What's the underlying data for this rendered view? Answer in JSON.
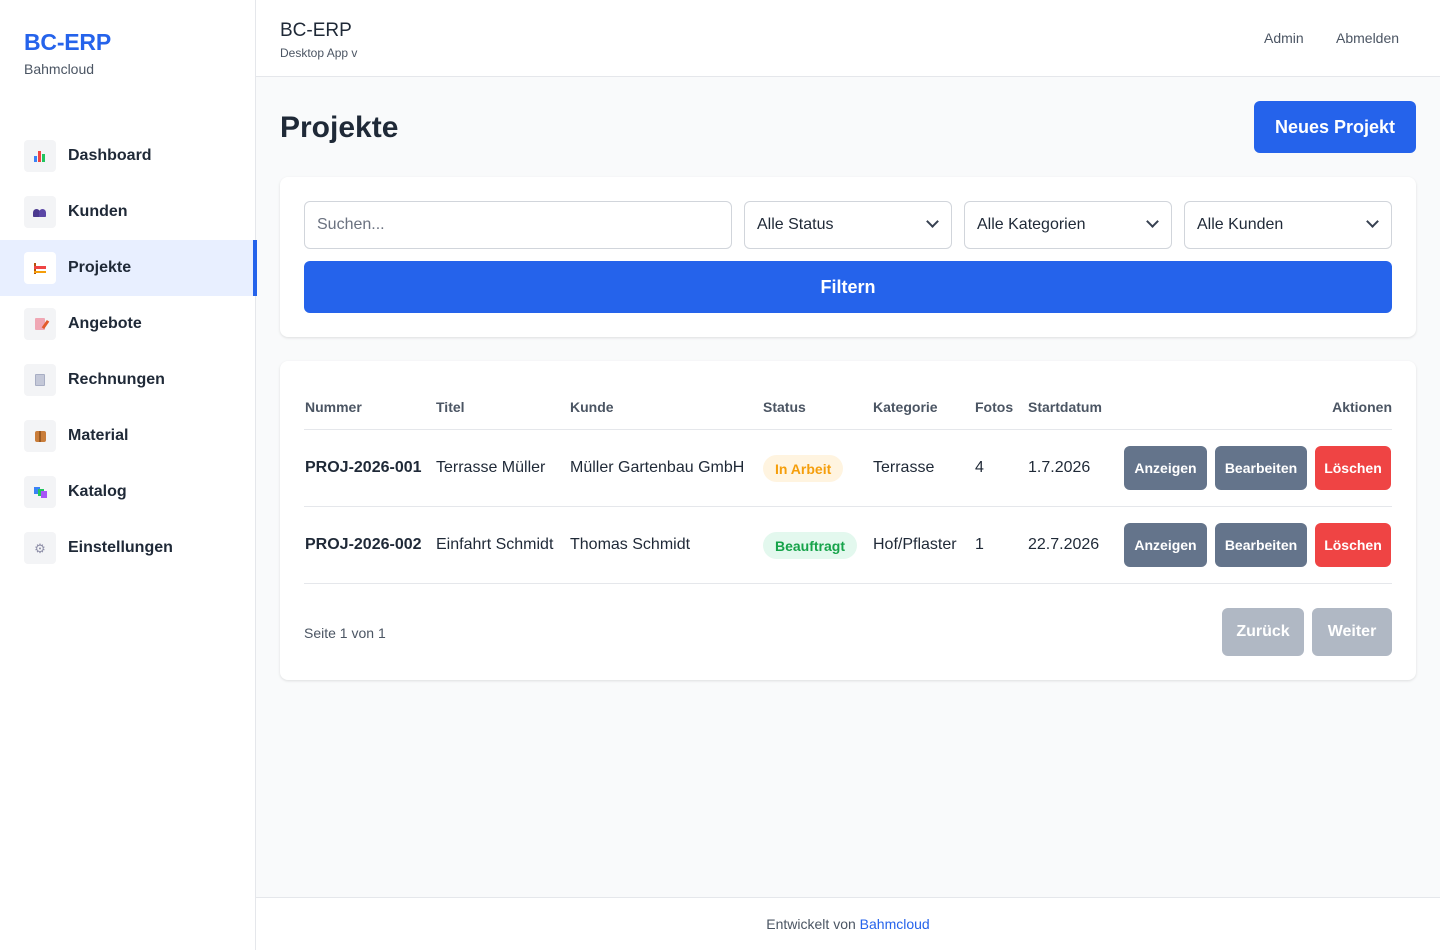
{
  "brand": {
    "title": "BC-ERP",
    "subtitle": "Bahmcloud"
  },
  "sidebar": {
    "items": [
      {
        "label": "Dashboard",
        "icon": "bar-chart-icon",
        "active": false
      },
      {
        "label": "Kunden",
        "icon": "users-icon",
        "active": false
      },
      {
        "label": "Projekte",
        "icon": "construction-icon",
        "active": true
      },
      {
        "label": "Angebote",
        "icon": "memo-icon",
        "active": false
      },
      {
        "label": "Rechnungen",
        "icon": "receipt-icon",
        "active": false
      },
      {
        "label": "Material",
        "icon": "package-icon",
        "active": false
      },
      {
        "label": "Katalog",
        "icon": "books-icon",
        "active": false
      },
      {
        "label": "Einstellungen",
        "icon": "gear-icon",
        "active": false
      }
    ]
  },
  "header": {
    "title": "BC-ERP",
    "subtitle": "Desktop App v",
    "admin_label": "Admin",
    "logout_label": "Abmelden"
  },
  "main": {
    "title": "Projekte",
    "new_button": "Neues Projekt"
  },
  "filters": {
    "search_placeholder": "Suchen...",
    "status_value": "Alle Status",
    "category_value": "Alle Kategorien",
    "customer_value": "Alle Kunden",
    "filter_button": "Filtern"
  },
  "table": {
    "columns": {
      "number": "Nummer",
      "title": "Titel",
      "customer": "Kunde",
      "status": "Status",
      "category": "Kategorie",
      "photos": "Fotos",
      "start": "Startdatum",
      "actions": "Aktionen"
    },
    "rows": [
      {
        "number": "PROJ-2026-001",
        "title": "Terrasse Müller",
        "customer": "Müller Gartenbau GmbH",
        "status": "In Arbeit",
        "category": "Terrasse",
        "photos": "4",
        "start": "1.7.2026"
      },
      {
        "number": "PROJ-2026-002",
        "title": "Einfahrt Schmidt",
        "customer": "Thomas Schmidt",
        "status": "Beauftragt",
        "category": "Hof/Pflaster",
        "photos": "1",
        "start": "22.7.2026"
      }
    ],
    "actions": {
      "view": "Anzeigen",
      "edit": "Bearbeiten",
      "delete": "Löschen"
    }
  },
  "pagination": {
    "info": "Seite 1 von 1",
    "prev": "Zurück",
    "next": "Weiter"
  },
  "footer": {
    "text": "Entwickelt von",
    "link": "Bahmcloud"
  },
  "colors": {
    "primary": "#2563eb",
    "danger": "#ef4444",
    "secondary": "#64748b",
    "status_in_progress_bg": "#fff4e0",
    "status_in_progress_fg": "#f59e0b",
    "status_assigned_bg": "#e3f8ee",
    "status_assigned_fg": "#16a34a"
  }
}
